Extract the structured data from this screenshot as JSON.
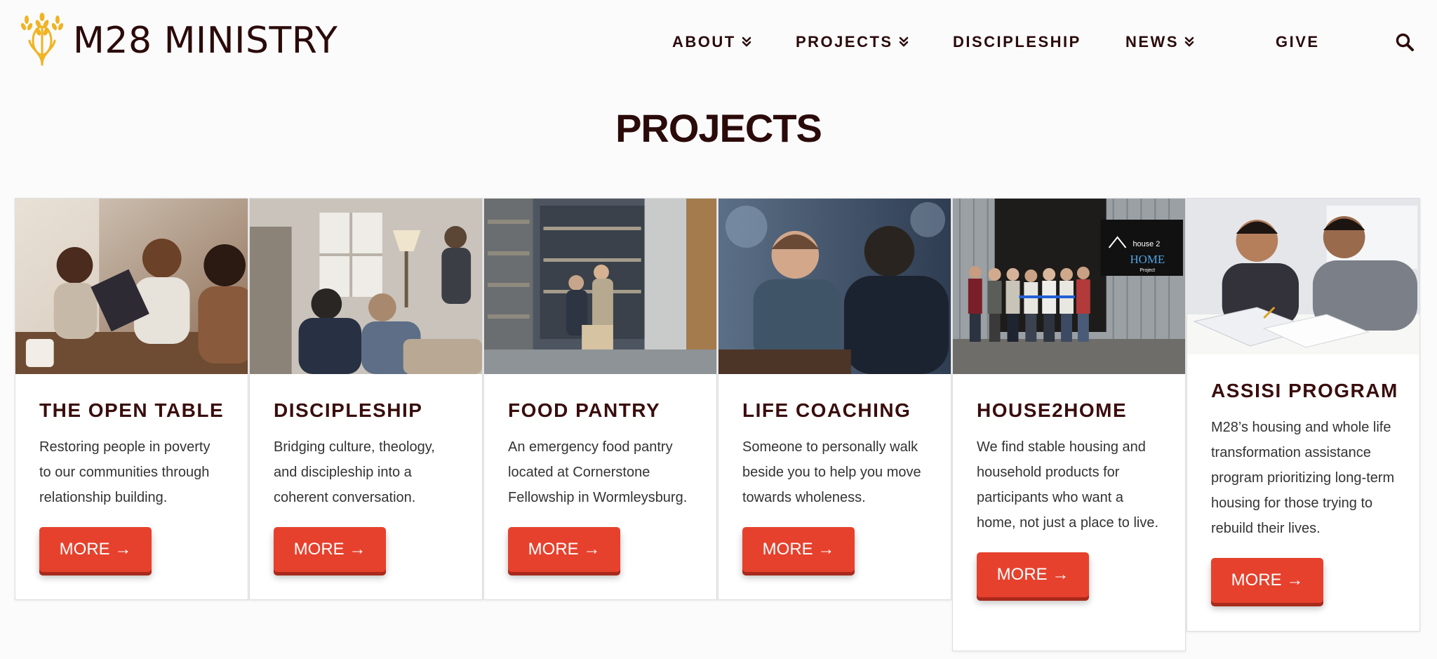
{
  "brand": {
    "name": "M28 MINISTRY",
    "logo_icon": "wheat-icon",
    "accent": "#f0b323"
  },
  "nav": {
    "items": [
      {
        "label": "ABOUT",
        "has_dropdown": true
      },
      {
        "label": "PROJECTS",
        "has_dropdown": true
      },
      {
        "label": "DISCIPLESHIP",
        "has_dropdown": false
      },
      {
        "label": "NEWS",
        "has_dropdown": true
      },
      {
        "label": "GIVE",
        "has_dropdown": false
      }
    ],
    "search_icon": "search-icon"
  },
  "page": {
    "title": "PROJECTS"
  },
  "cards": [
    {
      "title": "THE OPEN TABLE",
      "description": "Restoring people in poverty to our communities through relationship building.",
      "button": "MORE →",
      "image_alt": "women reading at a table"
    },
    {
      "title": "DISCIPLESHIP",
      "description": "Bridging culture, theology, and discipleship into a coherent conversation.",
      "button": "MORE →",
      "image_alt": "group conversation in living room"
    },
    {
      "title": "FOOD PANTRY",
      "description": "An emergency food pantry located at Cornerstone Fellowship in Wormleysburg.",
      "button": "MORE →",
      "image_alt": "people in a food pantry storeroom"
    },
    {
      "title": "LIFE COACHING",
      "description": "Someone to personally walk beside you to help you move towards wholeness.",
      "button": "MORE →",
      "image_alt": "two men talking at a cafe"
    },
    {
      "title": "HOUSE2HOME",
      "description": "We find stable housing and household products for participants who want a home, not just a place to live.",
      "button": "MORE →",
      "image_alt": "ribbon cutting at warehouse",
      "sign": {
        "line1": "house 2",
        "line2": "HOME",
        "line3": "Project"
      }
    },
    {
      "title": "ASSISI PROGRAM",
      "description": "M28’s housing and whole life transformation assistance program prioritizing long-term housing for those trying to rebuild their lives.",
      "button": "MORE →",
      "image_alt": "two men reviewing papers"
    }
  ],
  "colors": {
    "primary_text": "#2b0a0a",
    "button": "#e6412d",
    "button_shadow": "#a82a1c",
    "background": "#fbfbfb"
  }
}
